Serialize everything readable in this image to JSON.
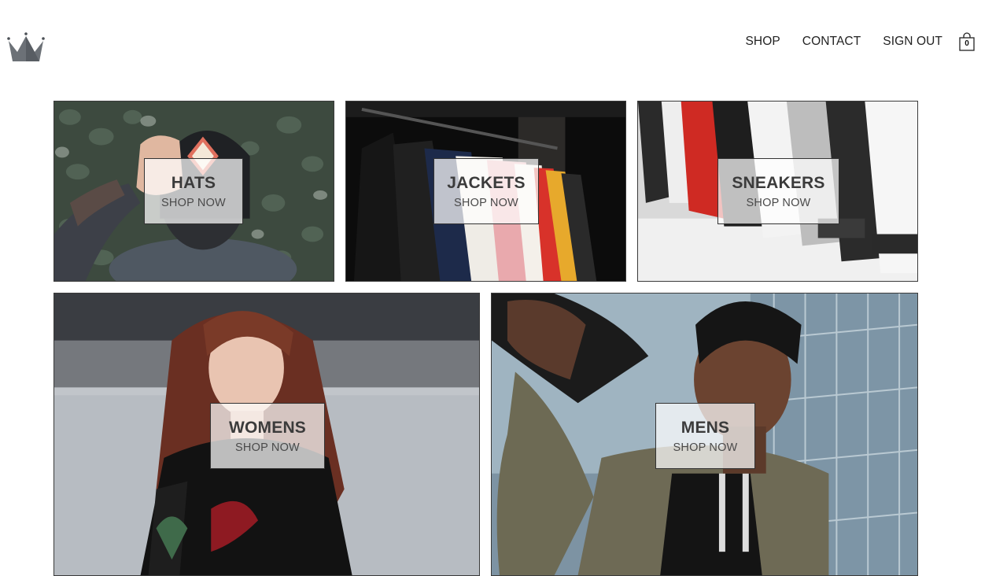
{
  "header": {
    "logo_icon": "crown-icon",
    "nav": [
      {
        "label": "SHOP"
      },
      {
        "label": "CONTACT"
      },
      {
        "label": "SIGN OUT"
      }
    ],
    "cart": {
      "icon": "shopping-bag-icon",
      "count": "0"
    }
  },
  "directory": {
    "items": [
      {
        "title": "HATS",
        "subtitle": "SHOP NOW"
      },
      {
        "title": "JACKETS",
        "subtitle": "SHOP NOW"
      },
      {
        "title": "SNEAKERS",
        "subtitle": "SHOP NOW"
      },
      {
        "title": "WOMENS",
        "subtitle": "SHOP NOW"
      },
      {
        "title": "MENS",
        "subtitle": "SHOP NOW"
      }
    ]
  }
}
